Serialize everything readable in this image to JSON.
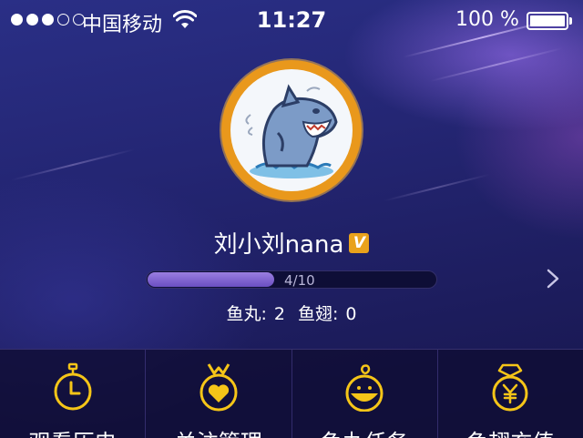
{
  "status_bar": {
    "carrier": "中国移动",
    "time": "11:27",
    "battery": "100 %",
    "signal_bars_filled": 3,
    "signal_bars_total": 5
  },
  "profile": {
    "username": "刘小刘nana",
    "vip_badge": "V",
    "level_progress_text": "4/10",
    "level_progress": 0.44,
    "yuwan_label": "鱼丸:",
    "yuwan_value": "2",
    "yuchi_label": "鱼翅:",
    "yuchi_value": "0"
  },
  "menu": {
    "items": [
      {
        "label": "观看历史",
        "icon": "stopwatch-icon"
      },
      {
        "label": "关注管理",
        "icon": "heart-medal-icon"
      },
      {
        "label": "鱼丸任务",
        "icon": "fishball-icon"
      },
      {
        "label": "鱼翅充值",
        "icon": "yen-medal-icon"
      }
    ]
  },
  "colors": {
    "accent": "#e9a21c",
    "progress": "#7b5fd0",
    "background": "#242674"
  }
}
